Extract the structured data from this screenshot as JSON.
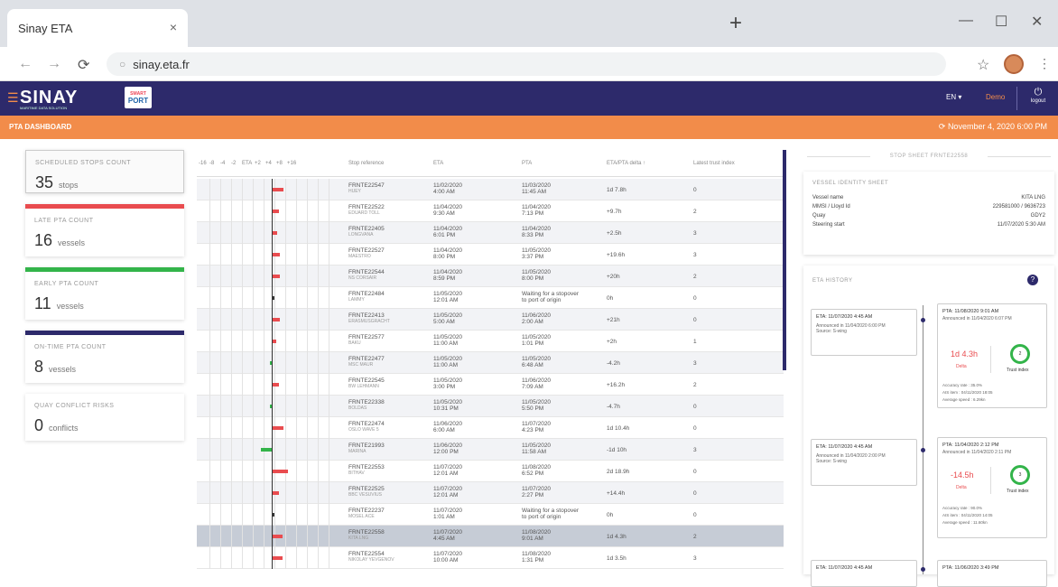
{
  "browser": {
    "tab_title": "Sinay ETA",
    "tab_close": "×",
    "new_tab": "+",
    "url": "sinay.eta.fr",
    "win_min": "—",
    "win_max": "☐",
    "win_close": "✕"
  },
  "app": {
    "brand": "SINAY",
    "brand_sub": "MARITIME DATA SOLUTION",
    "port_logo_top": "SMART",
    "port_logo_bottom": "PORT",
    "lang": "EN ▾",
    "demo": "Demo",
    "logout": "logout",
    "dashboard_title": "PTA DASHBOARD",
    "date": "November 4, 2020 6:00 PM"
  },
  "counters": [
    {
      "label": "SCHEDULED STOPS COUNT",
      "value": "35",
      "unit": "stops"
    },
    {
      "label": "LATE PTA COUNT",
      "value": "16",
      "unit": "vessels"
    },
    {
      "label": "EARLY PTA COUNT",
      "value": "11",
      "unit": "vessels"
    },
    {
      "label": "ON-TIME PTA COUNT",
      "value": "8",
      "unit": "vessels"
    },
    {
      "label": "QUAY CONFLICT RISKS",
      "value": "0",
      "unit": "conflicts"
    }
  ],
  "table": {
    "gantt_ticks": [
      "-16",
      "-8",
      "-4",
      "-2",
      "ETA",
      "+2",
      "+4",
      "+8",
      "+16"
    ],
    "headers": {
      "ref": "Stop reference",
      "eta": "ETA",
      "pta": "PTA",
      "delta": "ETA/PTA delta ↑",
      "trust": "Latest trust index"
    },
    "rows": [
      {
        "ref": "FRNTE22547",
        "vessel": "HUEY",
        "eta_d": "11/02/2020",
        "eta_t": "4:00 AM",
        "pta_d": "11/03/2020",
        "pta_t": "11:45 AM",
        "delta": "1d 7.8h",
        "trust": "0",
        "mark": 1.0,
        "color": "#e94c4f"
      },
      {
        "ref": "FRNTE22522",
        "vessel": "EDUARD TOLL",
        "eta_d": "11/04/2020",
        "eta_t": "9:30 AM",
        "pta_d": "11/04/2020",
        "pta_t": "7:13 PM",
        "delta": "+9.7h",
        "trust": "2",
        "mark": 0.6,
        "color": "#e94c4f"
      },
      {
        "ref": "FRNTE22405",
        "vessel": "LONGVANA",
        "eta_d": "11/04/2020",
        "eta_t": "6:01 PM",
        "pta_d": "11/04/2020",
        "pta_t": "8:33 PM",
        "delta": "+2.5h",
        "trust": "3",
        "mark": 0.4,
        "color": "#e94c4f"
      },
      {
        "ref": "FRNTE22527",
        "vessel": "MAESTRO",
        "eta_d": "11/04/2020",
        "eta_t": "8:00 PM",
        "pta_d": "11/05/2020",
        "pta_t": "3:37 PM",
        "delta": "+19.6h",
        "trust": "3",
        "mark": 0.7,
        "color": "#e94c4f"
      },
      {
        "ref": "FRNTE22544",
        "vessel": "NS CORSAIR",
        "eta_d": "11/04/2020",
        "eta_t": "8:59 PM",
        "pta_d": "11/05/2020",
        "pta_t": "8:00 PM",
        "delta": "+20h",
        "trust": "2",
        "mark": 0.7,
        "color": "#e94c4f"
      },
      {
        "ref": "FRNTE22484",
        "vessel": "LAMMY",
        "eta_d": "11/05/2020",
        "eta_t": "12:01 AM",
        "pta_d": "Waiting for a stopover",
        "pta_t": "to port of origin",
        "delta": "0h",
        "trust": "0",
        "mark": 0.1,
        "color": "#333333"
      },
      {
        "ref": "FRNTE22413",
        "vessel": "ERASMUSGRACHT",
        "eta_d": "11/05/2020",
        "eta_t": "5:00 AM",
        "pta_d": "11/06/2020",
        "pta_t": "2:00 AM",
        "delta": "+21h",
        "trust": "0",
        "mark": 0.7,
        "color": "#e94c4f"
      },
      {
        "ref": "FRNTE22577",
        "vessel": "BAKU",
        "eta_d": "11/05/2020",
        "eta_t": "11:00 AM",
        "pta_d": "11/05/2020",
        "pta_t": "1:01 PM",
        "delta": "+2h",
        "trust": "1",
        "mark": 0.3,
        "color": "#e94c4f"
      },
      {
        "ref": "FRNTE22477",
        "vessel": "MSC MAUR",
        "eta_d": "11/05/2020",
        "eta_t": "11:00 AM",
        "pta_d": "11/05/2020",
        "pta_t": "6:48 AM",
        "delta": "-4.2h",
        "trust": "3",
        "mark": -0.2,
        "color": "#33b44a"
      },
      {
        "ref": "FRNTE22545",
        "vessel": "BW LEHMANN",
        "eta_d": "11/05/2020",
        "eta_t": "3:00 PM",
        "pta_d": "11/06/2020",
        "pta_t": "7:09 AM",
        "delta": "+16.2h",
        "trust": "2",
        "mark": 0.6,
        "color": "#e94c4f"
      },
      {
        "ref": "FRNTE22338",
        "vessel": "BOLDAS",
        "eta_d": "11/05/2020",
        "eta_t": "10:31 PM",
        "pta_d": "11/05/2020",
        "pta_t": "5:50 PM",
        "delta": "-4.7h",
        "trust": "0",
        "mark": -0.2,
        "color": "#33b44a"
      },
      {
        "ref": "FRNTE22474",
        "vessel": "OSLO WAVE 5",
        "eta_d": "11/06/2020",
        "eta_t": "6:00 AM",
        "pta_d": "11/07/2020",
        "pta_t": "4:23 PM",
        "delta": "1d 10.4h",
        "trust": "0",
        "mark": 1.0,
        "color": "#e94c4f"
      },
      {
        "ref": "FRNTE21993",
        "vessel": "MARINA",
        "eta_d": "11/06/2020",
        "eta_t": "12:00 PM",
        "pta_d": "11/05/2020",
        "pta_t": "11:58 AM",
        "delta": "-1d 10h",
        "trust": "3",
        "mark": -1.0,
        "color": "#33b44a"
      },
      {
        "ref": "FRNTE22553",
        "vessel": "BITHAV",
        "eta_d": "11/07/2020",
        "eta_t": "12:01 AM",
        "pta_d": "11/08/2020",
        "pta_t": "6:52 PM",
        "delta": "2d 18.9h",
        "trust": "0",
        "mark": 1.4,
        "color": "#e94c4f"
      },
      {
        "ref": "FRNTE22525",
        "vessel": "BBC VESUVIUS",
        "eta_d": "11/07/2020",
        "eta_t": "12:01 AM",
        "pta_d": "11/07/2020",
        "pta_t": "2:27 PM",
        "delta": "+14.4h",
        "trust": "0",
        "mark": 0.6,
        "color": "#e94c4f"
      },
      {
        "ref": "FRNTE22237",
        "vessel": "MOSEL ACE",
        "eta_d": "11/07/2020",
        "eta_t": "1:01 AM",
        "pta_d": "Waiting for a stopover",
        "pta_t": "to port of origin",
        "delta": "0h",
        "trust": "0",
        "mark": 0.1,
        "color": "#333333"
      },
      {
        "ref": "FRNTE22558",
        "vessel": "KITA LNG",
        "eta_d": "11/07/2020",
        "eta_t": "4:45 AM",
        "pta_d": "11/08/2020",
        "pta_t": "9:01 AM",
        "delta": "1d 4.3h",
        "trust": "2",
        "mark": 0.9,
        "color": "#e94c4f"
      },
      {
        "ref": "FRNTE22554",
        "vessel": "NIKOLAY YEVGENOV",
        "eta_d": "11/07/2020",
        "eta_t": "10:00 AM",
        "pta_d": "11/08/2020",
        "pta_t": "1:31 PM",
        "delta": "1d 3.5h",
        "trust": "3",
        "mark": 0.9,
        "color": "#e94c4f"
      }
    ]
  },
  "stop_sheet": {
    "header": "STOP SHEET FRNTE22558",
    "vessel_title": "VESSEL IDENTITY SHEET",
    "fields": [
      {
        "k": "Vessel name",
        "v": "KITA LNG"
      },
      {
        "k": "MMSI / Lloyd Id",
        "v": "229581000 / 9636723"
      },
      {
        "k": "Quay",
        "v": "GDY2"
      },
      {
        "k": "Steering start",
        "v": "11/07/2020 5:30 AM"
      }
    ],
    "history_title": "ETA HISTORY",
    "help": "?",
    "entries": [
      {
        "eta_title": "ETA: 11/07/2020 4:45 AM",
        "eta_announced": "Announced in 11/04/2020 6:00 PM",
        "eta_source": "Source: S-wing",
        "pta_title": "PTA: 11/08/2020 9:01 AM",
        "pta_announced": "Announced in 11/04/2020 6:07 PM",
        "delta": "1d 4.3h",
        "delta_label": "Delta",
        "trust": "2",
        "trust_label": "Trust index",
        "accuracy": "Accuracy rate : 35.0%",
        "ais": "AIS item : 04/11/2020 18:05",
        "speed": "Average speed : 6.29kn"
      },
      {
        "eta_title": "ETA: 11/07/2020 4:45 AM",
        "eta_announced": "Announced in 11/04/2020 2:00 PM",
        "eta_source": "Source: S-wing",
        "pta_title": "PTA: 11/04/2020 2:12 PM",
        "pta_announced": "Announced in 11/04/2020 2:11 PM",
        "delta": "-14.5h",
        "delta_label": "Delta",
        "trust": "3",
        "trust_label": "Trust index",
        "accuracy": "Accuracy rate : 90.0%",
        "ais": "AIS item : 04/11/2020 14:05",
        "speed": "Average speed : 11.60kn"
      },
      {
        "eta_title": "ETA: 11/07/2020 4:45 AM",
        "pta_title": "PTA: 11/06/2020 3:49 PM"
      }
    ]
  }
}
